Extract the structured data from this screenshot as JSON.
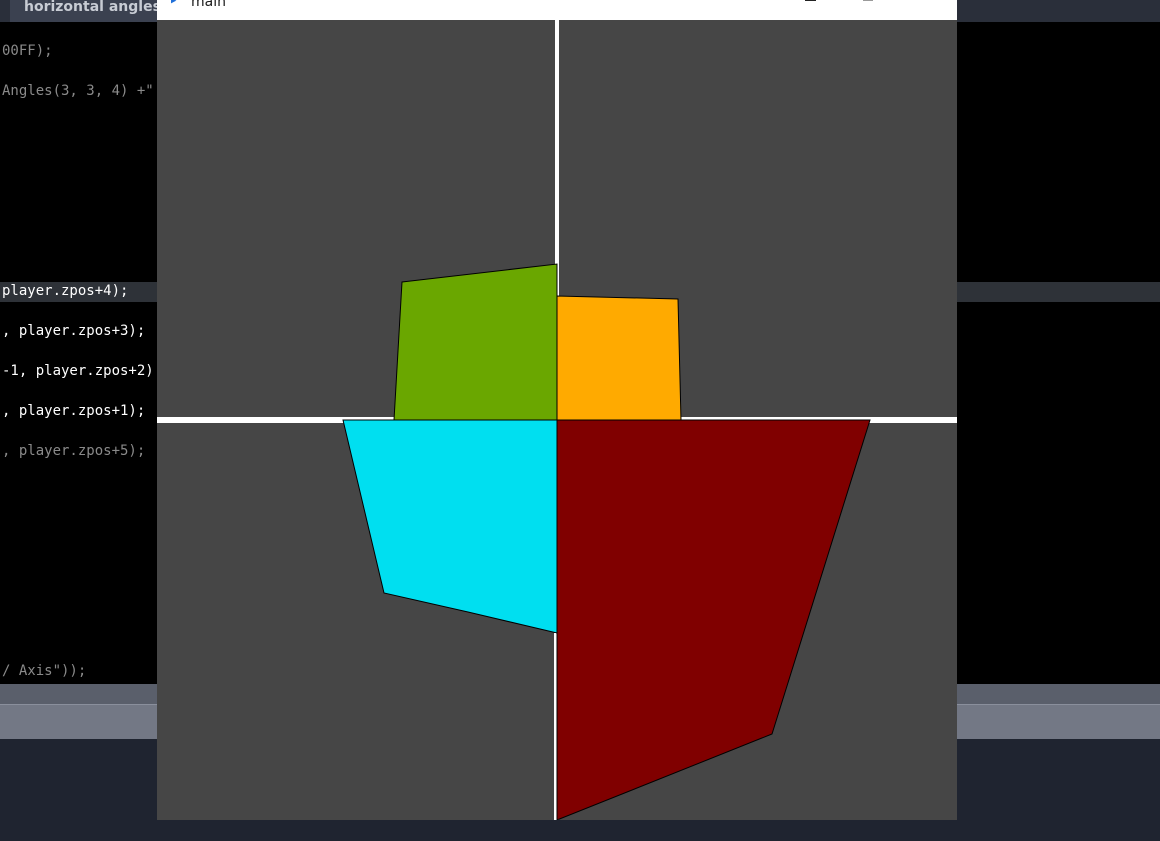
{
  "editor": {
    "tab_label": "horizontal angles",
    "code_lines": [
      {
        "text": "00FF);",
        "dim": true
      },
      {
        "text": "Angles(3, 3, 4) +\"",
        "dim": true
      },
      {
        "text": "player.zpos+4);",
        "dim": false
      },
      {
        "text": ", player.zpos+3);",
        "dim": false
      },
      {
        "text": "-1, player.zpos+2)",
        "dim": false
      },
      {
        "text": ", player.zpos+1);",
        "dim": false
      },
      {
        "text": ", player.zpos+5);",
        "dim": true
      },
      {
        "text": "/ Axis\"));",
        "dim": true
      },
      {
        "text": "' Axis\"));",
        "dim": true
      }
    ]
  },
  "window": {
    "title": "main",
    "title_icon": "processing-play-icon",
    "buttons": [
      "minimize",
      "maximize",
      "close"
    ],
    "close_glyph": "✕"
  },
  "canvas": {
    "background": "#464646",
    "axis_color": "#ffffff",
    "faces": [
      {
        "name": "green-face",
        "color": "#6aa700"
      },
      {
        "name": "orange-face",
        "color": "#ffaa00"
      },
      {
        "name": "cyan-face",
        "color": "#00dff0"
      },
      {
        "name": "darkred-face",
        "color": "#800000"
      }
    ]
  }
}
